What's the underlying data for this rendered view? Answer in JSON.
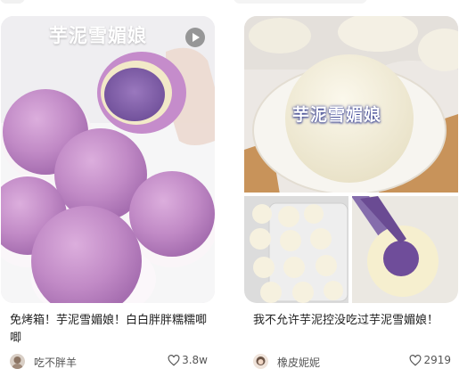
{
  "feed": {
    "cards": [
      {
        "overlay_title": "芋泥雪媚娘",
        "caption": "免烤箱！芋泥雪媚娘！白白胖胖糯糯唧唧",
        "author": "吃不胖羊",
        "likes": "3.8w",
        "has_video_badge": true
      },
      {
        "overlay_title": "芋泥雪媚娘",
        "caption": "我不允许芋泥控没吃过芋泥雪媚娘！",
        "author": "橡皮妮妮",
        "likes": "2919",
        "has_video_badge": false
      }
    ]
  },
  "icons": {
    "play": "play-icon",
    "like": "heart-outline-icon"
  },
  "colors": {
    "purple_mochi": "#c792c9",
    "taro_filling": "#8e6cb0",
    "cream": "#f4efdd"
  }
}
